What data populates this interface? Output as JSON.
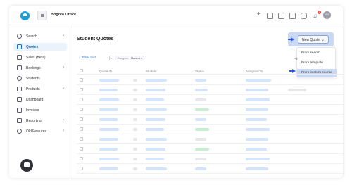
{
  "app": {
    "office_name": "Bogotá Office",
    "notification_count": "1",
    "avatar_initials": "GG"
  },
  "icons": {
    "logo": "app-logo",
    "office": "office-building-icon",
    "plus": "plus-icon",
    "calendar": "calendar-icon",
    "layout": "layout-icon",
    "clipboard": "clipboard-icon",
    "chat": "chat-icon",
    "bell": "bell-icon"
  },
  "sidebar": {
    "items": [
      {
        "label": "Search",
        "icon": "search-icon",
        "chevron": true
      },
      {
        "label": "Quotes",
        "icon": "quote-icon",
        "chevron": false,
        "active": true
      },
      {
        "label": "Sales (Beta)",
        "icon": "sales-icon",
        "chevron": false
      },
      {
        "label": "Bookings",
        "icon": "bookings-icon",
        "chevron": true
      },
      {
        "label": "Students",
        "icon": "students-icon",
        "chevron": false
      },
      {
        "label": "Products",
        "icon": "products-icon",
        "chevron": true
      },
      {
        "label": "Dashboard",
        "icon": "dashboard-icon",
        "chevron": false
      },
      {
        "label": "Invoices",
        "icon": "invoices-icon",
        "chevron": false
      },
      {
        "label": "Reporting",
        "icon": "reporting-icon",
        "chevron": true
      },
      {
        "label": "Old Features",
        "icon": "clock-icon",
        "chevron": true
      }
    ]
  },
  "main": {
    "title": "Student Quotes",
    "new_quote_label": "New Quote",
    "menu": [
      "From search",
      "From template",
      "From custom course"
    ],
    "filter_list_label": "Filter List",
    "chip_key": "Assignee",
    "chip_value": "Maria A",
    "page_label": "Pa",
    "columns": [
      "Quote ID",
      "Student",
      "Status",
      "Assigned To"
    ]
  },
  "colors": {
    "accent": "#1a6fd1",
    "highlight": "#c9d9f3",
    "pointer": "#2a5bd7"
  }
}
